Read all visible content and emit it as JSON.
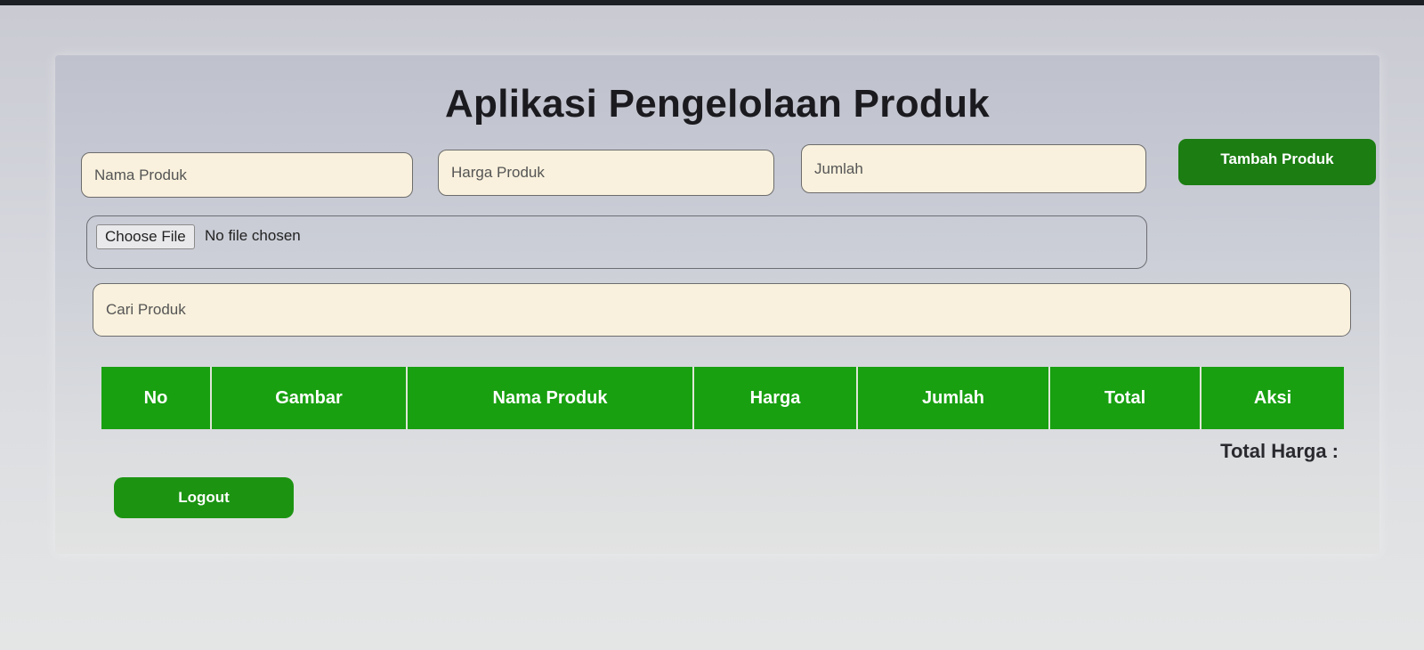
{
  "header": {
    "title": "Aplikasi Pengelolaan Produk"
  },
  "form": {
    "nama_placeholder": "Nama Produk",
    "harga_placeholder": "Harga Produk",
    "jumlah_placeholder": "Jumlah",
    "add_button_label": "Tambah Produk",
    "file_button_label": "Choose File",
    "file_status": "No file chosen"
  },
  "search": {
    "placeholder": "Cari Produk"
  },
  "table": {
    "headers": [
      "No",
      "Gambar",
      "Nama Produk",
      "Harga",
      "Jumlah",
      "Total",
      "Aksi"
    ],
    "rows": []
  },
  "summary": {
    "total_label": "Total Harga :"
  },
  "footer": {
    "logout_label": "Logout"
  },
  "colors": {
    "accent_green": "#18a010",
    "input_background": "#f9f1dd"
  }
}
